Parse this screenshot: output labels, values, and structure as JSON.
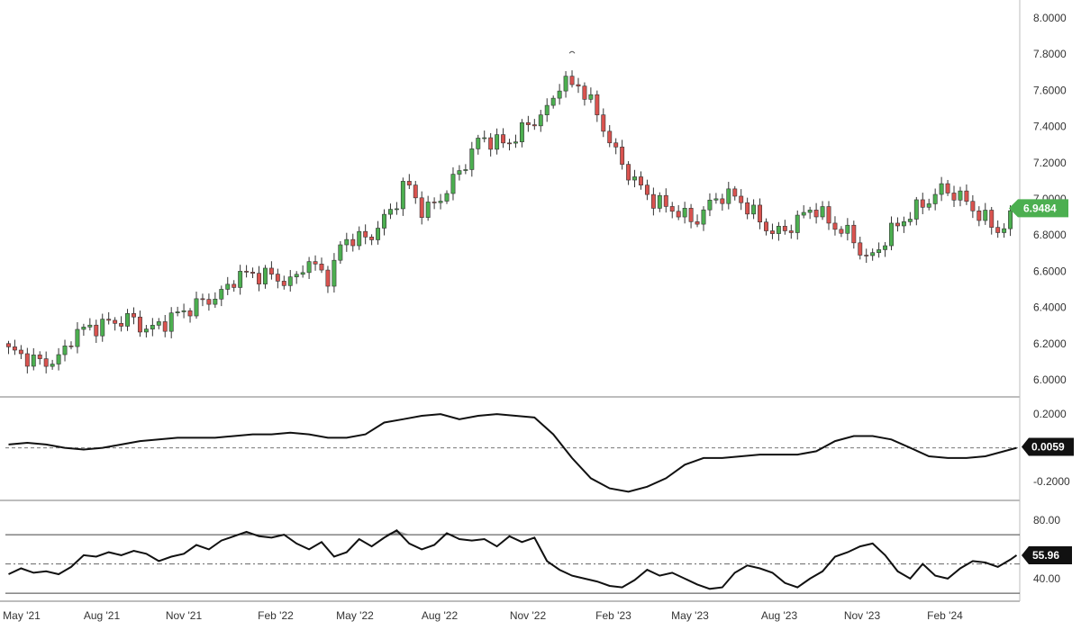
{
  "colors": {
    "up": "#4caf50",
    "down": "#d9534f",
    "wick": "#333333",
    "line": "#111111",
    "grid": "#bdbdbd",
    "last_price_bg": "#4caf50",
    "osc_label_bg": "#111111",
    "shade": "#9e9e9e"
  },
  "chart_data": [
    {
      "type": "candlestick",
      "ylim": [
        5.95,
        8.05
      ],
      "y_ticks": [
        "8.0000",
        "7.8000",
        "7.6000",
        "7.4000",
        "7.2000",
        "7.0000",
        "6.8000",
        "6.6000",
        "6.4000",
        "6.2000",
        "6.0000"
      ],
      "x_ticks": [
        "May '21",
        "Aug '21",
        "Nov '21",
        "Feb '22",
        "May '22",
        "Aug '22",
        "Nov '22",
        "Feb '23",
        "May '23",
        "Aug '23",
        "Nov '23",
        "Feb '24"
      ],
      "last_value_label": "6.9484",
      "last_value": 6.9484,
      "high_marker": 7.8
    },
    {
      "type": "line",
      "ylim": [
        -0.29,
        0.27
      ],
      "y_ticks": [
        "0.2000",
        "-0.2000"
      ],
      "zero_line": 0,
      "last_value_label": "0.0059",
      "last_value": 0.0059,
      "points": [
        [
          0,
          0.02
        ],
        [
          3,
          0.03
        ],
        [
          6,
          0.02
        ],
        [
          9,
          0.0
        ],
        [
          12,
          -0.01
        ],
        [
          15,
          0.0
        ],
        [
          18,
          0.02
        ],
        [
          21,
          0.04
        ],
        [
          24,
          0.05
        ],
        [
          27,
          0.06
        ],
        [
          30,
          0.06
        ],
        [
          33,
          0.06
        ],
        [
          36,
          0.07
        ],
        [
          39,
          0.08
        ],
        [
          42,
          0.08
        ],
        [
          45,
          0.09
        ],
        [
          48,
          0.08
        ],
        [
          51,
          0.06
        ],
        [
          54,
          0.06
        ],
        [
          57,
          0.08
        ],
        [
          60,
          0.15
        ],
        [
          63,
          0.17
        ],
        [
          66,
          0.19
        ],
        [
          69,
          0.2
        ],
        [
          72,
          0.17
        ],
        [
          75,
          0.19
        ],
        [
          78,
          0.2
        ],
        [
          81,
          0.19
        ],
        [
          84,
          0.18
        ],
        [
          87,
          0.08
        ],
        [
          90,
          -0.06
        ],
        [
          93,
          -0.18
        ],
        [
          96,
          -0.24
        ],
        [
          99,
          -0.26
        ],
        [
          102,
          -0.23
        ],
        [
          105,
          -0.18
        ],
        [
          108,
          -0.1
        ],
        [
          111,
          -0.06
        ],
        [
          114,
          -0.06
        ],
        [
          117,
          -0.05
        ],
        [
          120,
          -0.04
        ],
        [
          123,
          -0.04
        ],
        [
          126,
          -0.04
        ],
        [
          129,
          -0.02
        ],
        [
          132,
          0.04
        ],
        [
          135,
          0.07
        ],
        [
          138,
          0.07
        ],
        [
          141,
          0.05
        ],
        [
          144,
          0.0
        ],
        [
          147,
          -0.05
        ],
        [
          150,
          -0.06
        ],
        [
          153,
          -0.06
        ],
        [
          156,
          -0.05
        ],
        [
          159,
          -0.02
        ],
        [
          161,
          0.0
        ]
      ]
    },
    {
      "type": "line",
      "ylim": [
        27,
        91
      ],
      "y_ticks": [
        "80.00",
        "40.00"
      ],
      "upper_band": 70,
      "mid_band": 50,
      "lower_band": 30,
      "last_value_label": "55.96",
      "last_value": 55.96,
      "points": [
        [
          0,
          43
        ],
        [
          2,
          47
        ],
        [
          4,
          44
        ],
        [
          6,
          45
        ],
        [
          8,
          43
        ],
        [
          10,
          48
        ],
        [
          12,
          56
        ],
        [
          14,
          55
        ],
        [
          16,
          58
        ],
        [
          18,
          56
        ],
        [
          20,
          59
        ],
        [
          22,
          57
        ],
        [
          24,
          52
        ],
        [
          26,
          55
        ],
        [
          28,
          57
        ],
        [
          30,
          63
        ],
        [
          32,
          60
        ],
        [
          34,
          66
        ],
        [
          36,
          69
        ],
        [
          38,
          72
        ],
        [
          40,
          69
        ],
        [
          42,
          68
        ],
        [
          44,
          70
        ],
        [
          46,
          64
        ],
        [
          48,
          60
        ],
        [
          50,
          65
        ],
        [
          52,
          55
        ],
        [
          54,
          58
        ],
        [
          56,
          67
        ],
        [
          58,
          62
        ],
        [
          60,
          68
        ],
        [
          62,
          73
        ],
        [
          64,
          64
        ],
        [
          66,
          60
        ],
        [
          68,
          63
        ],
        [
          70,
          71
        ],
        [
          72,
          67
        ],
        [
          74,
          66
        ],
        [
          76,
          67
        ],
        [
          78,
          62
        ],
        [
          80,
          69
        ],
        [
          82,
          65
        ],
        [
          84,
          68
        ],
        [
          86,
          52
        ],
        [
          88,
          46
        ],
        [
          90,
          42
        ],
        [
          92,
          40
        ],
        [
          94,
          38
        ],
        [
          96,
          35
        ],
        [
          98,
          34
        ],
        [
          100,
          39
        ],
        [
          102,
          46
        ],
        [
          104,
          42
        ],
        [
          106,
          44
        ],
        [
          108,
          40
        ],
        [
          110,
          36
        ],
        [
          112,
          33
        ],
        [
          114,
          34
        ],
        [
          116,
          44
        ],
        [
          118,
          49
        ],
        [
          120,
          47
        ],
        [
          122,
          44
        ],
        [
          124,
          37
        ],
        [
          126,
          34
        ],
        [
          128,
          40
        ],
        [
          130,
          45
        ],
        [
          132,
          55
        ],
        [
          134,
          58
        ],
        [
          136,
          62
        ],
        [
          138,
          64
        ],
        [
          140,
          56
        ],
        [
          142,
          45
        ],
        [
          144,
          40
        ],
        [
          146,
          50
        ],
        [
          148,
          42
        ],
        [
          150,
          40
        ],
        [
          152,
          47
        ],
        [
          154,
          52
        ],
        [
          156,
          51
        ],
        [
          158,
          48
        ],
        [
          160,
          53
        ],
        [
          161,
          56
        ]
      ]
    }
  ]
}
